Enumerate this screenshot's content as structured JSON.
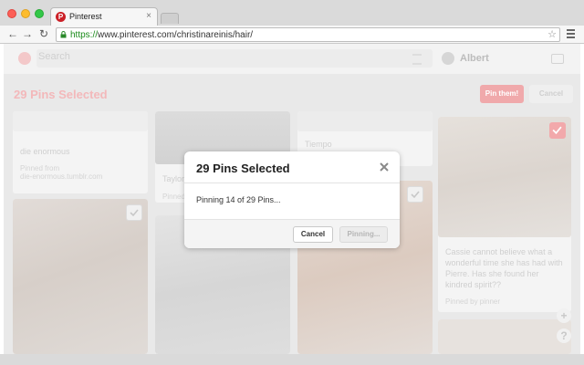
{
  "browser": {
    "tab_title": "Pinterest",
    "tab_favicon": "P",
    "tab_close": "×",
    "url_scheme": "https://",
    "url_rest": "www.pinterest.com/christinareinis/hair/",
    "icons": [
      "back-icon",
      "forward-icon",
      "reload-icon",
      "lock-icon",
      "star-icon",
      "menu-icon"
    ]
  },
  "header": {
    "search_placeholder": "Search",
    "user_name": "Albert"
  },
  "selection_bar": {
    "title": "29 Pins Selected",
    "pin_button": "Pin them!",
    "cancel_button": "Cancel"
  },
  "pins": {
    "pin1_desc": "die enormous",
    "pin1_source_label": "Pinned from",
    "pin1_source": "die-enormous.tumblr.com",
    "pin2_desc": "Taylor",
    "pin2_source": "Pinned",
    "pin3_desc": "Tiempo",
    "pin_right_desc": "Cassie cannot believe what a wonderful time she has had with Pierre. Has she found her kindred spirit??",
    "pin_right_source": "Pinned by pinner"
  },
  "floating": {
    "add": "+",
    "help": "?"
  },
  "modal": {
    "title": "29 Pins Selected",
    "progress_text": "Pinning 14 of 29 Pins...",
    "pins_done": 14,
    "pins_total": 29,
    "cancel_button": "Cancel",
    "pinning_button": "Pinning..."
  },
  "colors": {
    "pinterest_red": "#cb2027",
    "url_green": "#1a8a1a",
    "overlay_tint": "#e9e9e9"
  }
}
